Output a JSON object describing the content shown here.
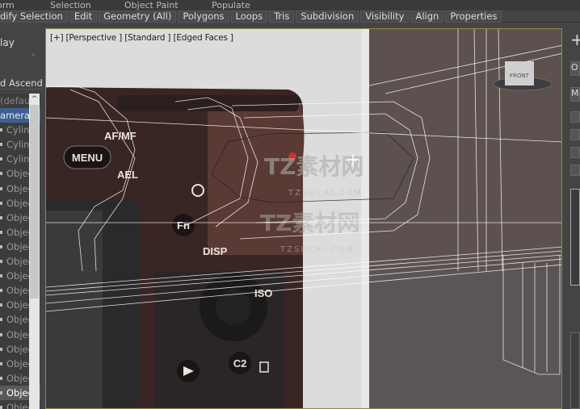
{
  "top_tabs": [
    "orm",
    "Selection",
    "Object Paint",
    "Populate"
  ],
  "ribbon": {
    "items": [
      "dify Selection",
      "Edit",
      "Geometry (All)",
      "Polygons",
      "Loops",
      "Tris",
      "Subdivision",
      "Visibility",
      "Align",
      "Properties"
    ]
  },
  "scene_explorer": {
    "display_label": "lay",
    "sort_label": "d Ascendin",
    "layers": [
      {
        "label": "(defaul",
        "type": "default"
      },
      {
        "label": "amera_",
        "type": "cam"
      },
      {
        "label": "Cylinc"
      },
      {
        "label": "Cylinc"
      },
      {
        "label": "Cylinc"
      },
      {
        "label": "Objec"
      },
      {
        "label": "Objec"
      },
      {
        "label": "Objec"
      },
      {
        "label": "Objec"
      },
      {
        "label": "Objec"
      },
      {
        "label": "Objec"
      },
      {
        "label": "Objec"
      },
      {
        "label": "Objec"
      },
      {
        "label": "Objec"
      },
      {
        "label": "Objec"
      },
      {
        "label": "Objec"
      },
      {
        "label": "Objec"
      },
      {
        "label": "Objec"
      },
      {
        "label": "Objec"
      },
      {
        "label": "Objec"
      },
      {
        "label": "Objec",
        "type": "sel"
      },
      {
        "label": "Objec"
      }
    ]
  },
  "viewport": {
    "label": "[+] [Perspective ] [Standard ] [Edged Faces ]",
    "viewcube_face": "FRONT",
    "camera_labels": {
      "menu": "MENU",
      "afmf": "AF/MF",
      "ael": "AEL",
      "fn": "Fn",
      "disp": "DISP",
      "iso": "ISO",
      "c2": "C2"
    },
    "watermark": {
      "cn": "TZ素材网",
      "en": "TZSUCAI.COM"
    }
  },
  "command_panel": {
    "row1": "O",
    "row2": "M"
  }
}
